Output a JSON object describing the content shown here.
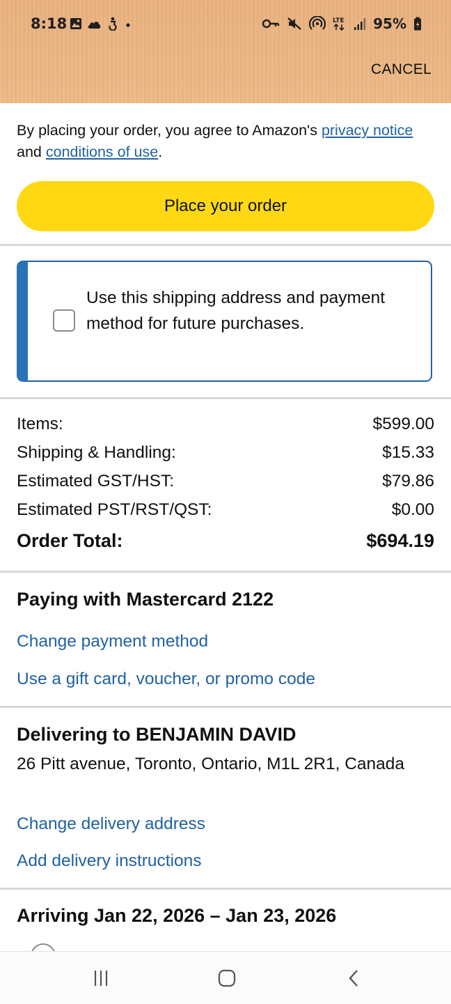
{
  "status_bar": {
    "time": "8:18",
    "battery": "95%",
    "icons_left": [
      "gallery-icon",
      "cloud-icon",
      "accessibility-icon",
      "dot-icon"
    ],
    "icons_right": [
      "key-icon",
      "mute-icon",
      "hotspot-icon",
      "lte-icon",
      "signal-icon",
      "battery-icon"
    ]
  },
  "header": {
    "cancel_label": "CANCEL"
  },
  "agreement": {
    "prefix": "By placing your order, you agree to Amazon's ",
    "privacy_link": "privacy notice",
    "middle": " and ",
    "conditions_link": "conditions of use",
    "suffix": "."
  },
  "place_order": {
    "label": "Place your order"
  },
  "future_purchases": {
    "checked": false,
    "label": "Use this shipping address and payment method for future purchases."
  },
  "summary": {
    "rows": [
      {
        "label": "Items:",
        "value": "$599.00"
      },
      {
        "label": "Shipping & Handling:",
        "value": "$15.33"
      },
      {
        "label": "Estimated GST/HST:",
        "value": "$79.86"
      },
      {
        "label": "Estimated PST/RST/QST:",
        "value": "$0.00"
      }
    ],
    "total_label": "Order Total:",
    "total_value": "$694.19"
  },
  "payment": {
    "title": "Paying with Mastercard 2122",
    "change_link": "Change payment method",
    "gift_link": "Use a gift card, voucher, or promo code"
  },
  "delivery": {
    "title": "Delivering to BENJAMIN DAVID",
    "address": "26 Pitt avenue, Toronto, Ontario, M1L 2R1, Canada",
    "change_link": "Change delivery address",
    "instructions_link": "Add delivery instructions"
  },
  "arrival": {
    "title": "Arriving Jan 22, 2026 – Jan 23, 2026"
  },
  "colors": {
    "header_bg": "#ecb885",
    "button_yellow": "#ffd814",
    "link_blue": "#2162a1",
    "box_accent": "#2a72b8"
  }
}
